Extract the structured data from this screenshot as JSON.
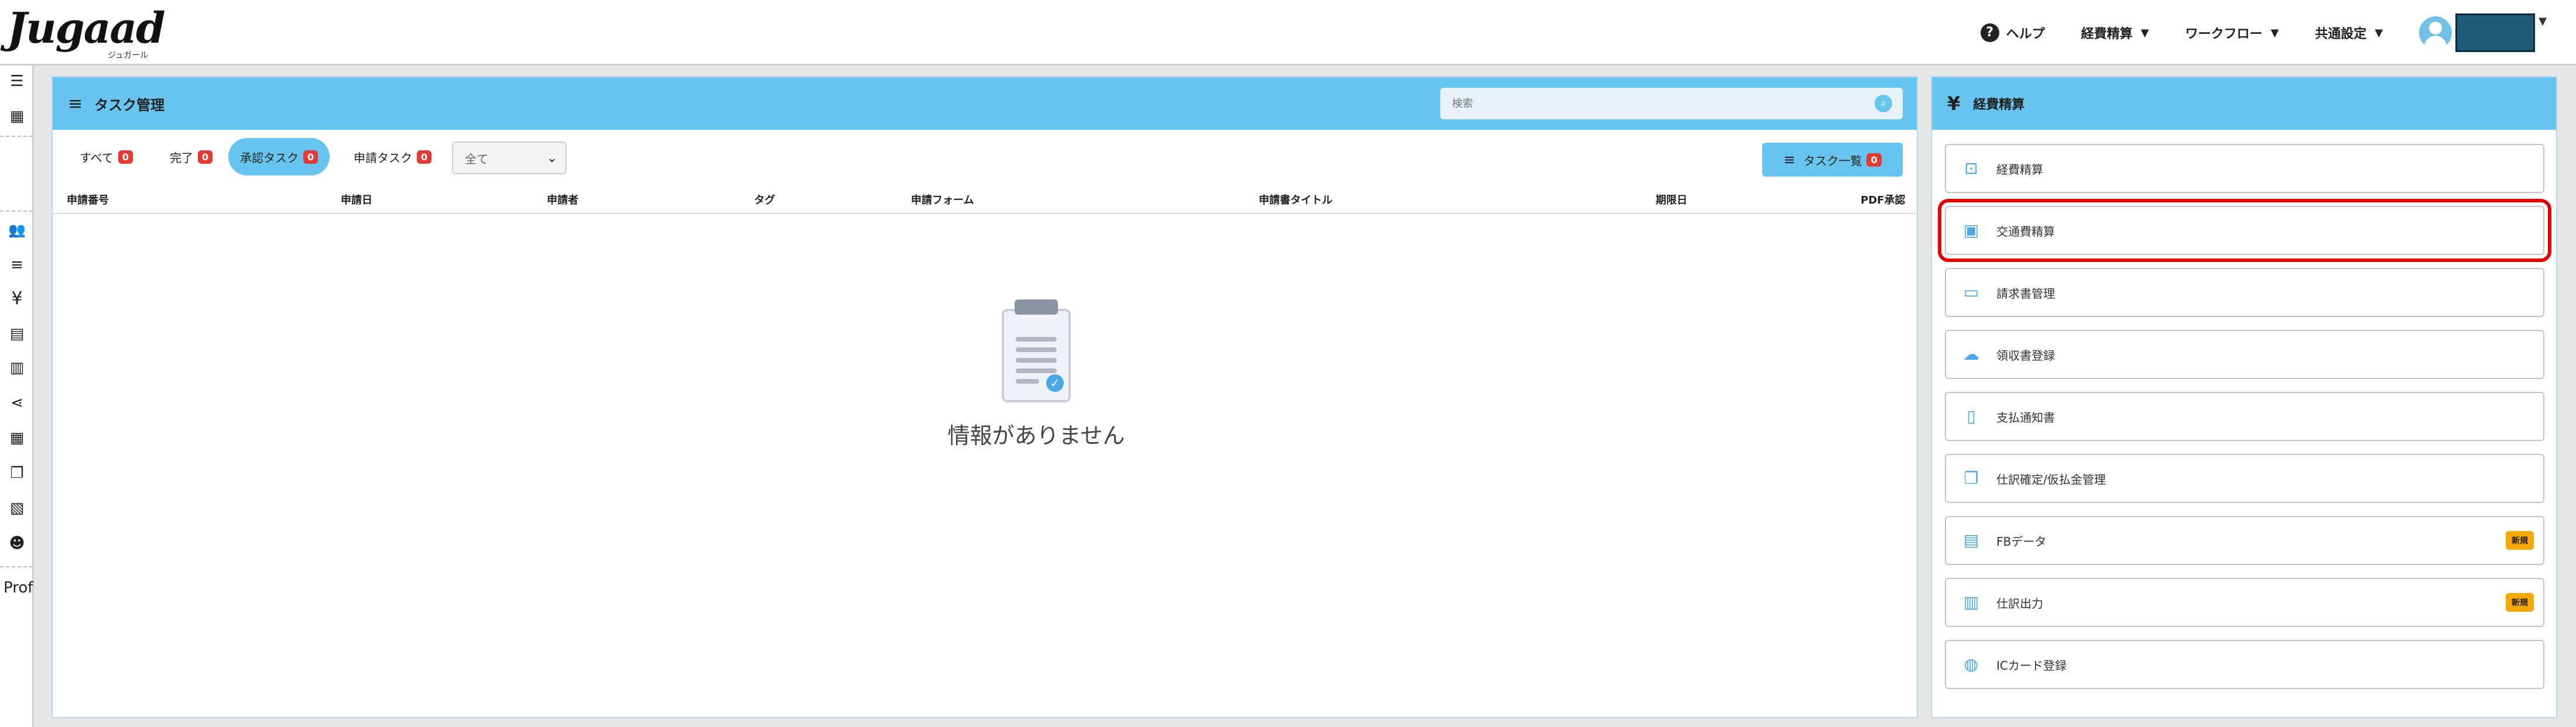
{
  "header": {
    "logo": "Jugaad",
    "logo_sub": "ジュガール",
    "help": "ヘルプ",
    "nav": [
      "経費精算",
      "ワークフロー",
      "共通設定"
    ]
  },
  "sidebar": {
    "bottom_label": "Prof"
  },
  "task": {
    "title": "タスク管理",
    "search_placeholder": "検索",
    "tabs": [
      {
        "label": "すべて",
        "count": "0"
      },
      {
        "label": "完了",
        "count": "0"
      },
      {
        "label": "承認タスク",
        "count": "0"
      },
      {
        "label": "申請タスク",
        "count": "0"
      }
    ],
    "filter_value": "全て",
    "task_list_button": "タスク一覧",
    "task_list_count": "0",
    "columns": [
      "申請番号",
      "申請日",
      "申請者",
      "タグ",
      "申請フォーム",
      "申請書タイトル",
      "期限日",
      "PDF承認"
    ],
    "empty_message": "情報がありません"
  },
  "expense": {
    "title": "経費精算",
    "new_label": "新規",
    "items": [
      {
        "label": "経費精算",
        "icon": "money-icon"
      },
      {
        "label": "交通費精算",
        "icon": "train-icon"
      },
      {
        "label": "請求書管理",
        "icon": "card-icon"
      },
      {
        "label": "領収書登録",
        "icon": "cloud-upload-icon"
      },
      {
        "label": "支払通知書",
        "icon": "receipt-icon"
      },
      {
        "label": "仕訳確定/仮払金管理",
        "icon": "copy-icon"
      },
      {
        "label": "FBデータ",
        "icon": "book-icon"
      },
      {
        "label": "仕訳出力",
        "icon": "export-icon"
      },
      {
        "label": "ICカード登録",
        "icon": "globe-icon"
      }
    ]
  },
  "colors": {
    "accent": "#66c4ee",
    "badge": "#e53935",
    "new_tag": "#f5a800",
    "highlight": "#e00000"
  }
}
